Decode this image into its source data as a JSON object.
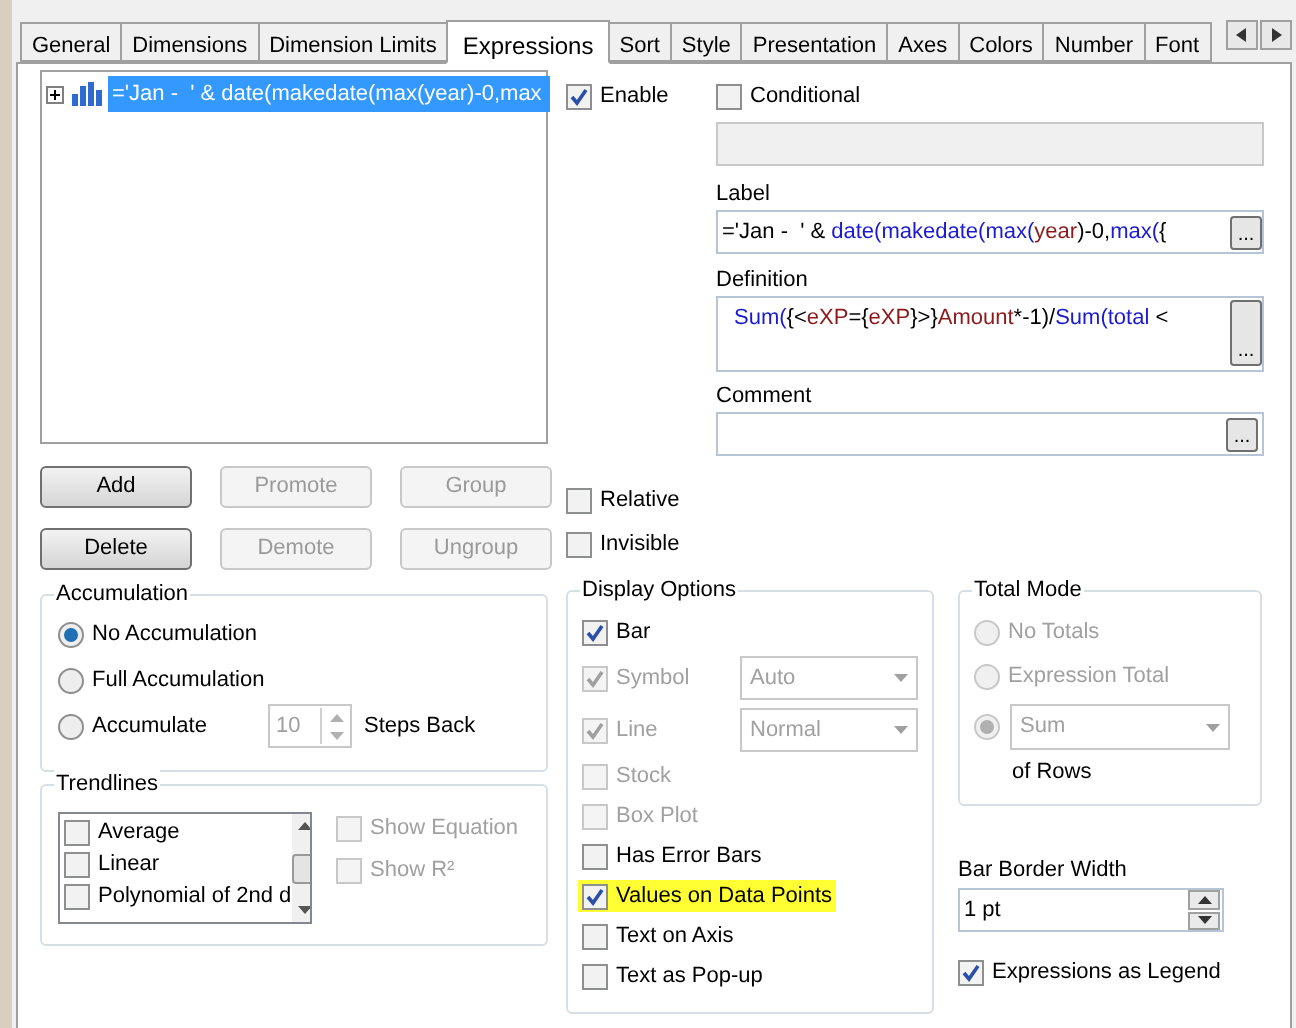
{
  "tabs": [
    {
      "label": "General",
      "selected": false
    },
    {
      "label": "Dimensions",
      "selected": false
    },
    {
      "label": "Dimension Limits",
      "selected": false
    },
    {
      "label": "Expressions",
      "selected": true
    },
    {
      "label": "Sort",
      "selected": false
    },
    {
      "label": "Style",
      "selected": false
    },
    {
      "label": "Presentation",
      "selected": false
    },
    {
      "label": "Axes",
      "selected": false
    },
    {
      "label": "Colors",
      "selected": false
    },
    {
      "label": "Number",
      "selected": false
    },
    {
      "label": "Font",
      "selected": false
    }
  ],
  "expressions": [
    {
      "text": "='Jan -  ' & date(makedate(max(year)-0,max",
      "selected": true,
      "expanded": false
    }
  ],
  "list_buttons": [
    {
      "label": "Add",
      "disabled": false
    },
    {
      "label": "Promote",
      "disabled": true
    },
    {
      "label": "Group",
      "disabled": true
    },
    {
      "label": "Delete",
      "disabled": false
    },
    {
      "label": "Demote",
      "disabled": true
    },
    {
      "label": "Ungroup",
      "disabled": true
    }
  ],
  "enable": {
    "label": "Enable",
    "checked": true
  },
  "conditional": {
    "label": "Conditional",
    "checked": false,
    "value_disabled": true
  },
  "label_field": {
    "label": "Label",
    "tokens": [
      {
        "text": "='Jan -  ' & ",
        "kind": "plain"
      },
      {
        "text": "date(",
        "kind": "function"
      },
      {
        "text": "makedate(",
        "kind": "function"
      },
      {
        "text": "max(",
        "kind": "function"
      },
      {
        "text": "year",
        "kind": "field"
      },
      {
        "text": ")-0,",
        "kind": "plain"
      },
      {
        "text": "max(",
        "kind": "function"
      },
      {
        "text": "{",
        "kind": "plain"
      }
    ],
    "button": "..."
  },
  "definition_field": {
    "label": "Definition",
    "tokens": [
      {
        "text": "Sum(",
        "kind": "function"
      },
      {
        "text": "{<",
        "kind": "plain"
      },
      {
        "text": "eXP",
        "kind": "field"
      },
      {
        "text": "={",
        "kind": "plain"
      },
      {
        "text": "eXP",
        "kind": "field"
      },
      {
        "text": "}>}",
        "kind": "plain"
      },
      {
        "text": "Amount",
        "kind": "field"
      },
      {
        "text": "*-1)/",
        "kind": "plain"
      },
      {
        "text": "Sum(",
        "kind": "function"
      },
      {
        "text": "total",
        "kind": "function"
      },
      {
        "text": " <",
        "kind": "plain"
      }
    ],
    "button": "..."
  },
  "comment_field": {
    "label": "Comment",
    "button": "..."
  },
  "relative": {
    "label": "Relative",
    "checked": false
  },
  "invisible": {
    "label": "Invisible",
    "checked": false
  },
  "accumulation": {
    "title": "Accumulation",
    "options": [
      {
        "label": "No Accumulation",
        "selected": true
      },
      {
        "label": "Full Accumulation",
        "selected": false
      },
      {
        "label": "Accumulate",
        "selected": false
      }
    ],
    "steps": "10",
    "steps_label": "Steps Back"
  },
  "trendlines": {
    "title": "Trendlines",
    "items": [
      {
        "label": "Average",
        "checked": false
      },
      {
        "label": "Linear",
        "checked": false
      },
      {
        "label": "Polynomial of 2nd d",
        "checked": false
      }
    ],
    "options": [
      {
        "label": "Show Equation",
        "checked": false,
        "disabled": true
      },
      {
        "label": "Show R²",
        "checked": false,
        "disabled": true
      }
    ]
  },
  "display_options": {
    "title": "Display Options",
    "items": [
      {
        "label": "Bar",
        "checked": true,
        "disabled": false,
        "highlighted": false
      },
      {
        "label": "Symbol",
        "checked": true,
        "disabled": true,
        "highlighted": false,
        "dropdown": "Auto"
      },
      {
        "label": "Line",
        "checked": true,
        "disabled": true,
        "highlighted": false,
        "dropdown": "Normal"
      },
      {
        "label": "Stock",
        "checked": false,
        "disabled": true,
        "highlighted": false
      },
      {
        "label": "Box Plot",
        "checked": false,
        "disabled": true,
        "highlighted": false
      },
      {
        "label": "Has Error Bars",
        "checked": false,
        "disabled": false,
        "highlighted": false
      },
      {
        "label": "Values on Data Points",
        "checked": true,
        "disabled": false,
        "highlighted": true
      },
      {
        "label": "Text on Axis",
        "checked": false,
        "disabled": false,
        "highlighted": false
      },
      {
        "label": "Text as Pop-up",
        "checked": false,
        "disabled": false,
        "highlighted": false
      }
    ]
  },
  "total_mode": {
    "title": "Total Mode",
    "options": [
      {
        "label": "No Totals",
        "selected": false
      },
      {
        "label": "Expression Total",
        "selected": false
      },
      {
        "label": "Sum",
        "selected": true
      }
    ],
    "suffix": "of Rows"
  },
  "bar_border_width": {
    "label": "Bar Border Width",
    "value": "1 pt"
  },
  "expressions_as_legend": {
    "label": "Expressions as Legend",
    "checked": true
  }
}
